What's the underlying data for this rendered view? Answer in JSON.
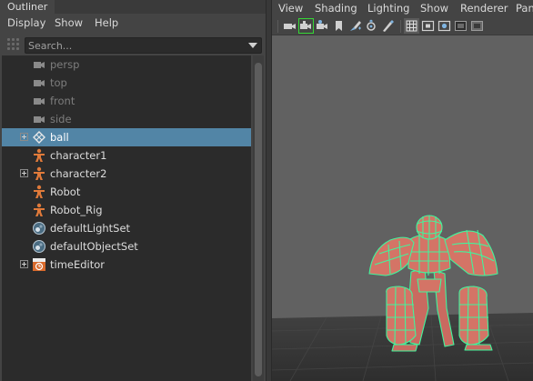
{
  "outliner": {
    "tab_title": "Outliner",
    "menus": [
      "Display",
      "Show",
      "Help"
    ],
    "search_placeholder": "Search...",
    "items": [
      {
        "label": "persp",
        "icon": "camera-icon",
        "expandable": false,
        "dim": true
      },
      {
        "label": "top",
        "icon": "camera-icon",
        "expandable": false,
        "dim": true
      },
      {
        "label": "front",
        "icon": "camera-icon",
        "expandable": false,
        "dim": true
      },
      {
        "label": "side",
        "icon": "camera-icon",
        "expandable": false,
        "dim": true
      },
      {
        "label": "ball",
        "icon": "nurbs-sphere-icon",
        "expandable": true,
        "selected": true
      },
      {
        "label": "character1",
        "icon": "character-icon",
        "expandable": false
      },
      {
        "label": "character2",
        "icon": "character-icon",
        "expandable": true
      },
      {
        "label": "Robot",
        "icon": "character-icon",
        "expandable": false
      },
      {
        "label": "Robot_Rig",
        "icon": "character-icon",
        "expandable": false
      },
      {
        "label": "defaultLightSet",
        "icon": "set-icon",
        "expandable": false
      },
      {
        "label": "defaultObjectSet",
        "icon": "set-icon",
        "expandable": false
      },
      {
        "label": "timeEditor",
        "icon": "time-editor-icon",
        "expandable": true
      }
    ]
  },
  "viewport": {
    "menus": [
      "View",
      "Shading",
      "Lighting",
      "Show",
      "Renderer",
      "Pan"
    ],
    "toolbar": [
      "select-camera-icon",
      "camera-attributes-icon",
      "bookmarks-icon",
      "image-plane-icon",
      "grease-pencil-icon",
      "2d-pan-zoom-icon",
      "isolate-icon",
      "grid-icon",
      "film-gate-icon",
      "resolution-gate-icon",
      "gate-mask-icon",
      "field-chart-icon"
    ],
    "highlighted_tool": "camera-attributes-icon",
    "colors": {
      "background": "#616161",
      "floor": "#393939",
      "mesh_fill": "#d47466",
      "wire": "#41f59c",
      "selection": "#5285a6"
    }
  }
}
